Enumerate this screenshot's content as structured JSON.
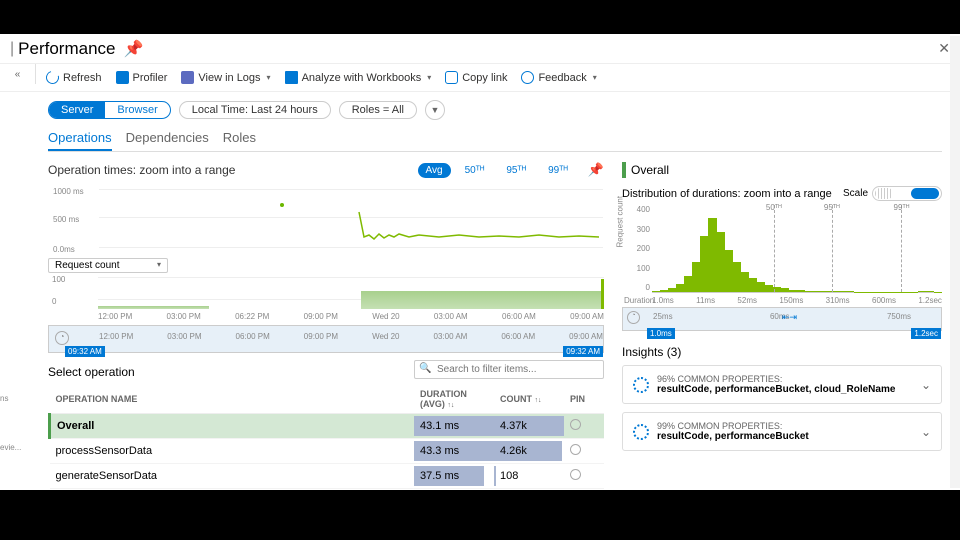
{
  "page": {
    "title": "Performance"
  },
  "toolbar": {
    "refresh": "Refresh",
    "profiler": "Profiler",
    "logs": "View in Logs",
    "workbooks": "Analyze with Workbooks",
    "copy": "Copy link",
    "feedback": "Feedback"
  },
  "leftedge": {
    "collapse": "«"
  },
  "pills": {
    "server": "Server",
    "browser": "Browser",
    "time": "Local Time: Last 24 hours",
    "roles": "Roles = All"
  },
  "tabs": {
    "operations": "Operations",
    "dependencies": "Dependencies",
    "roles": "Roles"
  },
  "chart1": {
    "title": "Operation times: zoom into a range",
    "agg": {
      "avg": "Avg",
      "p50": "50ᵀᴴ",
      "p95": "95ᵀᴴ",
      "p99": "99ᵀᴴ"
    },
    "yticks": [
      "1000 ms",
      "500 ms",
      "0.0ms"
    ],
    "selector": "Request count",
    "yticks2": [
      "100",
      "0"
    ],
    "xticks": [
      "12:00 PM",
      "03:00 PM",
      "06:22 PM",
      "09:00 PM",
      "Wed 20",
      "03:00 AM",
      "06:00 AM",
      "09:00 AM"
    ],
    "brush_ticks": [
      "12:00 PM",
      "03:00 PM",
      "06:00 PM",
      "09:00 PM",
      "Wed 20",
      "03:00 AM",
      "06:00 AM",
      "09:00 AM"
    ],
    "brush_start": "09:32 AM",
    "brush_end": "09:32 AM"
  },
  "ops": {
    "select_title": "Select operation",
    "search_placeholder": "Search to filter items...",
    "cols": {
      "name": "OPERATION NAME",
      "dur": "DURATION (AVG)",
      "count": "COUNT",
      "pin": "PIN"
    },
    "rows": [
      {
        "name": "Overall",
        "dur": "43.1 ms",
        "count": "4.37k",
        "dbar": 100,
        "cbar": 100,
        "sel": true
      },
      {
        "name": "processSensorData",
        "dur": "43.3 ms",
        "count": "4.26k",
        "dbar": 100,
        "cbar": 97
      },
      {
        "name": "generateSensorData",
        "dur": "37.5 ms",
        "count": "108",
        "dbar": 87,
        "cbar": 3
      }
    ]
  },
  "side": {
    "overall": "Overall",
    "dist_title": "Distribution of durations: zoom into a range",
    "scale": "Scale",
    "ylab": "Request count",
    "yticks": [
      "400",
      "300",
      "200",
      "100",
      "0"
    ],
    "percentiles": [
      {
        "label": "50ᵀᴴ",
        "pos": 42
      },
      {
        "label": "95ᵀᴴ",
        "pos": 62
      },
      {
        "label": "99ᵀᴴ",
        "pos": 86
      }
    ],
    "xlabel": "Duration",
    "xticks": [
      "1.0ms",
      "11ms",
      "52ms",
      "150ms",
      "310ms",
      "600ms",
      "1.2sec"
    ],
    "brush_ticks": [
      "25ms",
      "60ms",
      "750ms"
    ],
    "brush_start": "1.0ms",
    "brush_end": "1.2sec",
    "insights_title": "Insights (3)",
    "cards": [
      {
        "t": "96% COMMON PROPERTIES:",
        "b": "resultCode, performanceBucket, cloud_RoleName"
      },
      {
        "t": "99% COMMON PROPERTIES:",
        "b": "resultCode, performanceBucket"
      }
    ]
  },
  "peek": {
    "a": "ns",
    "b": "evie..."
  },
  "chart_data": {
    "type": "area",
    "title": "Request count over time",
    "x": [
      "12:00 PM",
      "03:00 PM",
      "06:00 PM",
      "09:00 PM",
      "Wed 20",
      "03:00 AM",
      "06:00 AM",
      "09:00 AM"
    ],
    "series": [
      {
        "name": "Request count",
        "values": [
          0,
          0,
          0,
          10,
          55,
          55,
          55,
          55,
          90
        ]
      }
    ],
    "ylim": [
      0,
      100
    ],
    "distribution": {
      "type": "bar",
      "title": "Distribution of durations",
      "xlabel": "Duration",
      "ylabel": "Request count",
      "ylim": [
        0,
        400
      ],
      "buckets_ms": [
        1,
        11,
        52,
        150,
        310,
        600,
        1200
      ],
      "values": [
        5,
        10,
        20,
        40,
        80,
        150,
        280,
        370,
        300,
        210,
        150,
        100,
        70,
        50,
        35,
        25,
        18,
        12,
        8,
        5,
        5,
        3,
        3,
        4,
        3,
        2,
        2,
        2,
        1,
        1,
        1,
        1,
        2,
        3,
        4,
        2
      ]
    }
  }
}
